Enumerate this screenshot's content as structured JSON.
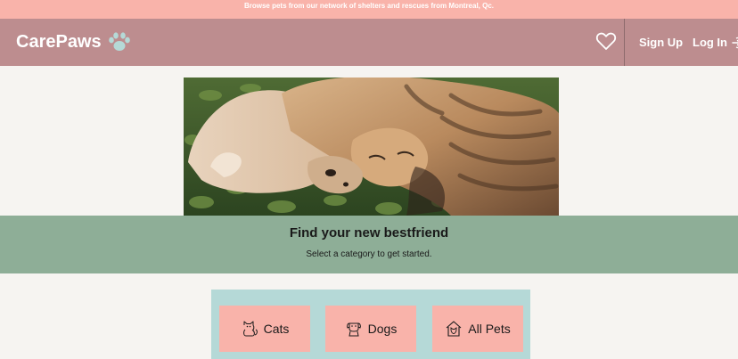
{
  "banner": {
    "text": "Browse pets from our network of shelters and rescues from Montreal, Qc."
  },
  "header": {
    "logo_text": "CarePaws",
    "signup_label": "Sign Up",
    "login_label": "Log In"
  },
  "hero": {
    "title": "Find your new bestfriend",
    "subtitle": "Select a category to get started."
  },
  "categories": [
    {
      "label": "Cats",
      "icon": "cat-icon"
    },
    {
      "label": "Dogs",
      "icon": "dog-icon"
    },
    {
      "label": "All Pets",
      "icon": "pet-house-icon"
    }
  ],
  "colors": {
    "banner": "#f9b3aa",
    "header": "#bd8d8f",
    "band": "#8eae97",
    "panel": "#b5d9d7",
    "button": "#f9b3aa",
    "paw": "#b5d9d7"
  }
}
